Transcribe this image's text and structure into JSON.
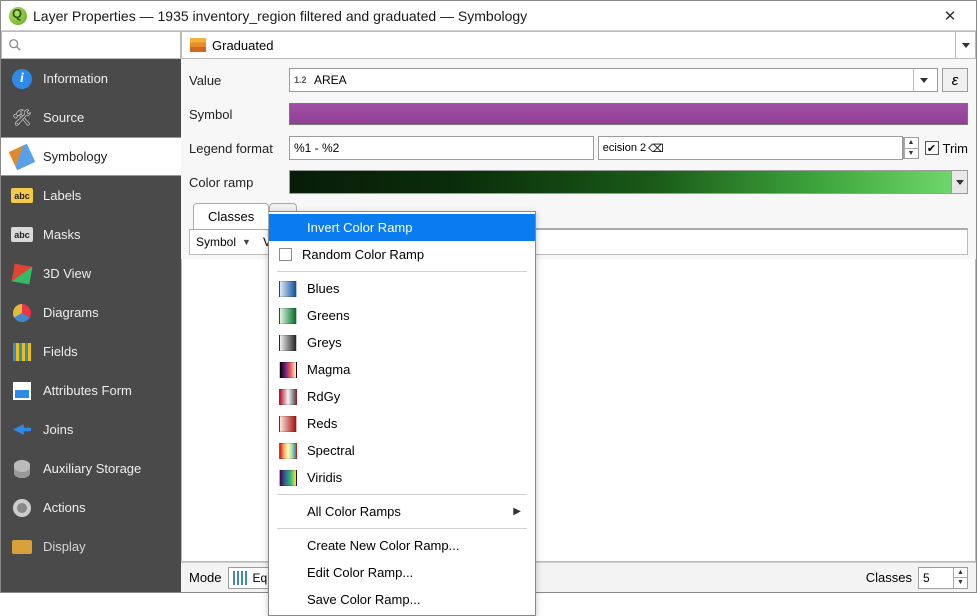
{
  "titlebar": {
    "app_glyph": "Q",
    "title": "Layer Properties — 1935 inventory_region filtered and graduated — Symbology"
  },
  "sidebar": {
    "search_placeholder": "",
    "items": [
      {
        "id": "information",
        "label": "Information"
      },
      {
        "id": "source",
        "label": "Source"
      },
      {
        "id": "symbology",
        "label": "Symbology",
        "active": true
      },
      {
        "id": "labels",
        "label": "Labels"
      },
      {
        "id": "masks",
        "label": "Masks"
      },
      {
        "id": "3dview",
        "label": "3D View"
      },
      {
        "id": "diagrams",
        "label": "Diagrams"
      },
      {
        "id": "fields",
        "label": "Fields"
      },
      {
        "id": "attrform",
        "label": "Attributes Form"
      },
      {
        "id": "joins",
        "label": "Joins"
      },
      {
        "id": "auxstorage",
        "label": "Auxiliary Storage"
      },
      {
        "id": "actions",
        "label": "Actions"
      },
      {
        "id": "display",
        "label": "Display"
      }
    ]
  },
  "renderer_selector": {
    "label": "Graduated"
  },
  "form": {
    "value_label": "Value",
    "value_typehint": "1.2",
    "value_field": "AREA",
    "expression_glyph": "ε",
    "symbol_label": "Symbol",
    "symbol_color": "#954C9B",
    "legendfmt_label": "Legend format",
    "legendfmt_value": "%1 - %2",
    "precision_text": "ecision 2",
    "precision_clear_glyph": "⌫",
    "trim_label": "Trim",
    "trim_checked": true,
    "colorramp_label": "Color ramp",
    "colorramp_stops": [
      "#081c08",
      "#6ed66a"
    ]
  },
  "tabs": {
    "classes": "Classes",
    "histogram_initial": "H"
  },
  "columns": {
    "symbol": "Symbol",
    "values_initial": "V"
  },
  "bottom": {
    "mode_label": "Mode",
    "mode_value_visible": "Equa",
    "classes_label": "Classes",
    "classes_value": "5"
  },
  "context_menu": {
    "items": [
      {
        "kind": "hl",
        "label": "Invert Color Ramp"
      },
      {
        "kind": "check",
        "label": "Random Color Ramp"
      },
      {
        "kind": "sep"
      },
      {
        "kind": "ramp",
        "label": "Blues",
        "stops": [
          "#deebf7",
          "#08519c"
        ]
      },
      {
        "kind": "ramp",
        "label": "Greens",
        "stops": [
          "#e5f5e0",
          "#006d2c"
        ]
      },
      {
        "kind": "ramp",
        "label": "Greys",
        "stops": [
          "#f0f0f0",
          "#252525"
        ]
      },
      {
        "kind": "ramp",
        "label": "Magma",
        "stops": [
          "#000004",
          "#721f81",
          "#f1605d",
          "#fcfdbf"
        ]
      },
      {
        "kind": "ramp",
        "label": "RdGy",
        "stops": [
          "#b2182b",
          "#f7f7f7",
          "#4d4d4d"
        ]
      },
      {
        "kind": "ramp",
        "label": "Reds",
        "stops": [
          "#fee5d9",
          "#a50f15"
        ]
      },
      {
        "kind": "ramp",
        "label": "Spectral",
        "stops": [
          "#d7191c",
          "#fdae61",
          "#ffffbf",
          "#abdda4",
          "#2b83ba"
        ]
      },
      {
        "kind": "ramp",
        "label": "Viridis",
        "stops": [
          "#440154",
          "#31688e",
          "#35b779",
          "#fde725"
        ]
      },
      {
        "kind": "sep"
      },
      {
        "kind": "sub",
        "label": "All Color Ramps"
      },
      {
        "kind": "sep"
      },
      {
        "kind": "plain",
        "label": "Create New Color Ramp..."
      },
      {
        "kind": "plain",
        "label": "Edit Color Ramp..."
      },
      {
        "kind": "plain",
        "label": "Save Color Ramp..."
      }
    ]
  }
}
